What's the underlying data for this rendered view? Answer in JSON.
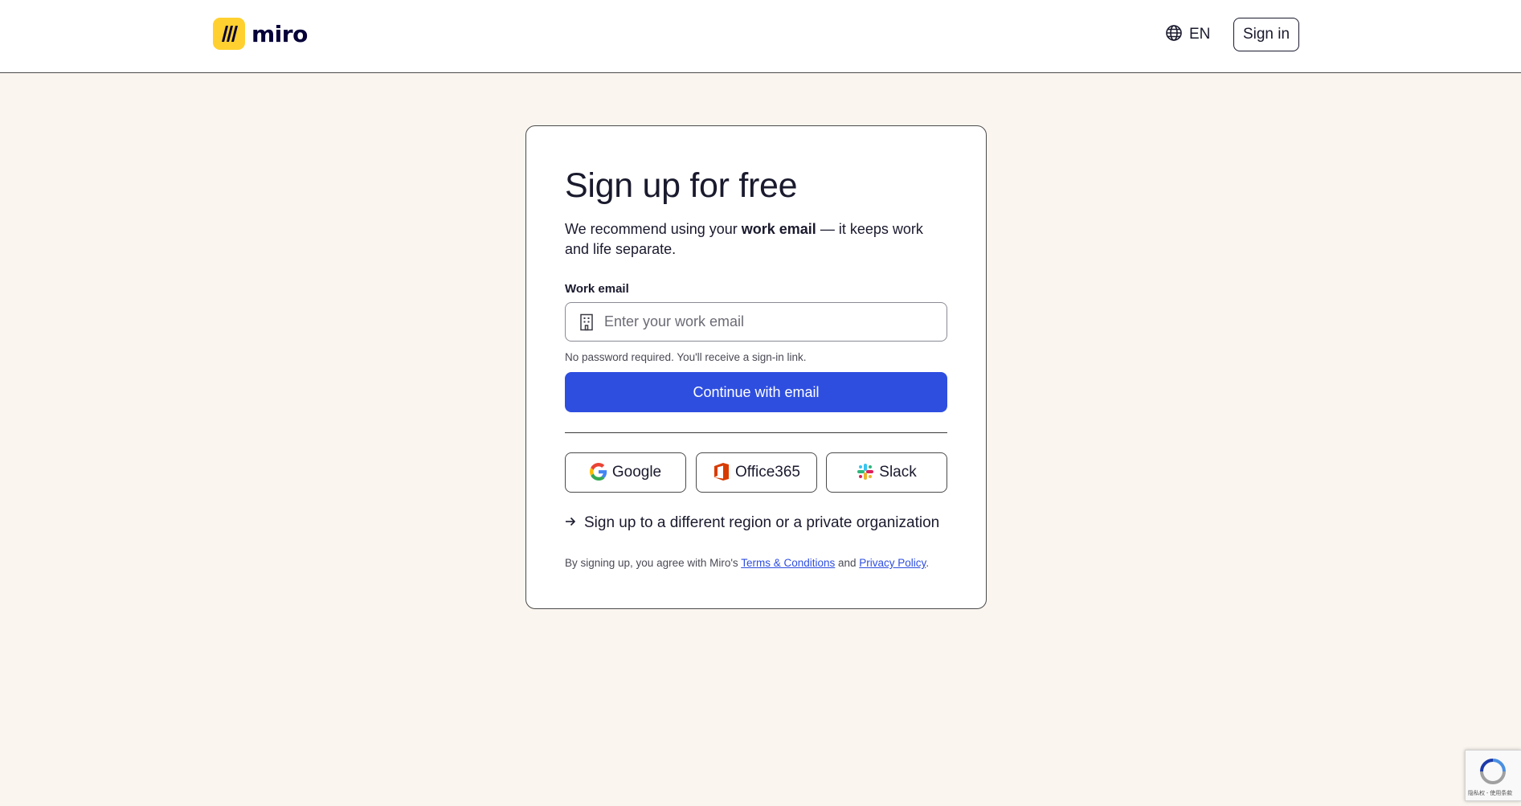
{
  "header": {
    "brand": "miro",
    "language": "EN",
    "sign_in_label": "Sign in"
  },
  "signup": {
    "title": "Sign up for free",
    "subtitle_before": "We recommend using your ",
    "subtitle_bold": "work email",
    "subtitle_after": " — it keeps work and life separate.",
    "email_label": "Work email",
    "email_placeholder": "Enter your work email",
    "email_value": "",
    "hint": "No password required. You'll receive a sign-in link.",
    "continue_label": "Continue with email",
    "sso": [
      {
        "label": "Google",
        "icon": "google-icon"
      },
      {
        "label": "Office365",
        "icon": "office365-icon"
      },
      {
        "label": "Slack",
        "icon": "slack-icon"
      }
    ],
    "region_link": "Sign up to a different region or a private organization",
    "legal_before": "By signing up, you agree with Miro's ",
    "terms_label": "Terms & Conditions",
    "legal_middle": " and ",
    "privacy_label": "Privacy Policy",
    "legal_after": "."
  },
  "recaptcha": {
    "text": "隐私权 - 使用条款"
  },
  "colors": {
    "background": "#faf5ef",
    "primary": "#2e4ee0",
    "brand_yellow": "#ffd02f"
  }
}
